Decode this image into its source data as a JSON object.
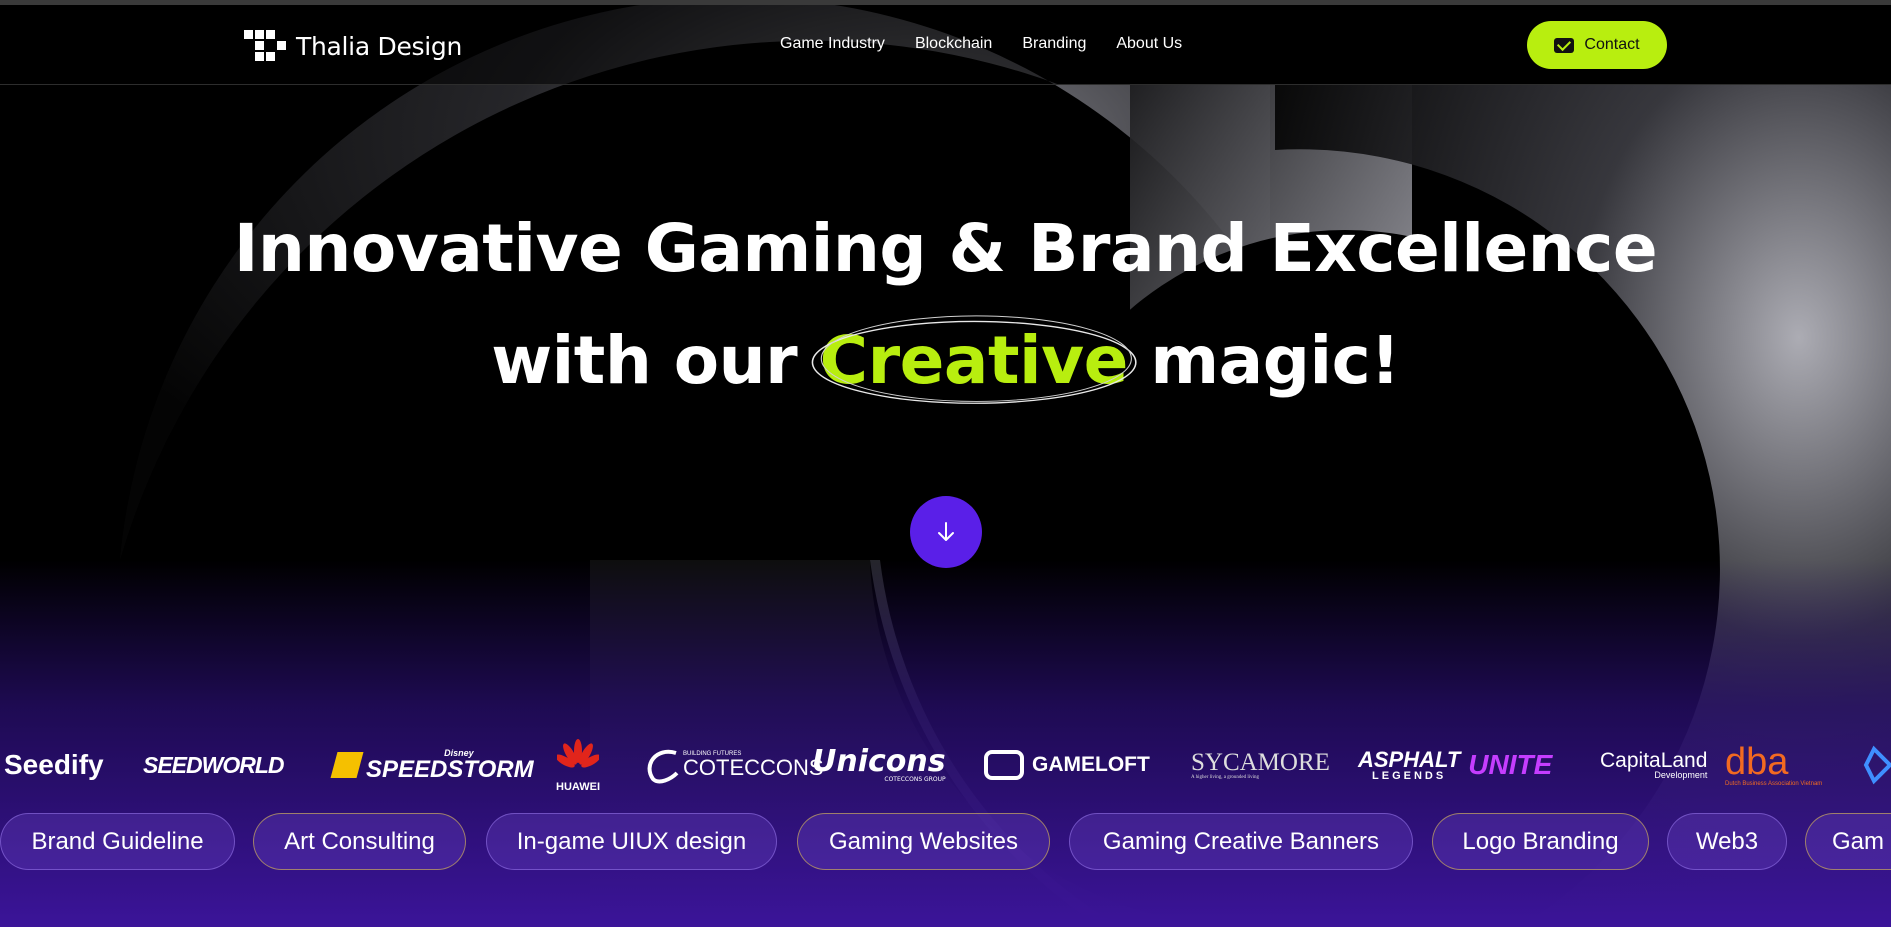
{
  "header": {
    "logo_main": "Thalia",
    "logo_sub": "Design",
    "nav": [
      "Game Industry",
      "Blockchain",
      "Branding",
      "About Us"
    ],
    "contact_label": "Contact"
  },
  "hero": {
    "line1": "Innovative Gaming & Brand Excellence",
    "line2_before": "with our",
    "line2_highlight": "Creative",
    "line2_after": "magic!"
  },
  "brands": {
    "seedify": "Seedify",
    "seedworld": "SEEDWORLD",
    "speedstorm_tag": "Disney",
    "speedstorm": "SPEEDSTORM",
    "huawei": "HUAWEI",
    "coteccons_tag": "BUILDING FUTURES",
    "coteccons": "COTECCONS",
    "unicons": "Unicons",
    "unicons_sub": "COTECCONS GROUP",
    "gameloft": "GAMELOFT",
    "sycamore": "SYCAMORE",
    "sycamore_sub": "A higher living, a grounded living",
    "asphalt": "ASPHALT",
    "asphalt_sub": "LEGENDS",
    "unite": "UNITE",
    "capitaland": "CapitaLand",
    "capitaland_sub": "Development",
    "dba": "dba",
    "dba_sub": "Dutch Business Association Vietnam"
  },
  "tags": [
    "Brand Guideline",
    "Art Consulting",
    "In-game UIUX design",
    "Gaming Websites",
    "Gaming Creative Banners",
    "Logo Branding",
    "Web3",
    "Gam"
  ],
  "colors": {
    "accent_lime": "#b8ee0f",
    "accent_purple": "#5a1fe8",
    "background": "#000000"
  }
}
